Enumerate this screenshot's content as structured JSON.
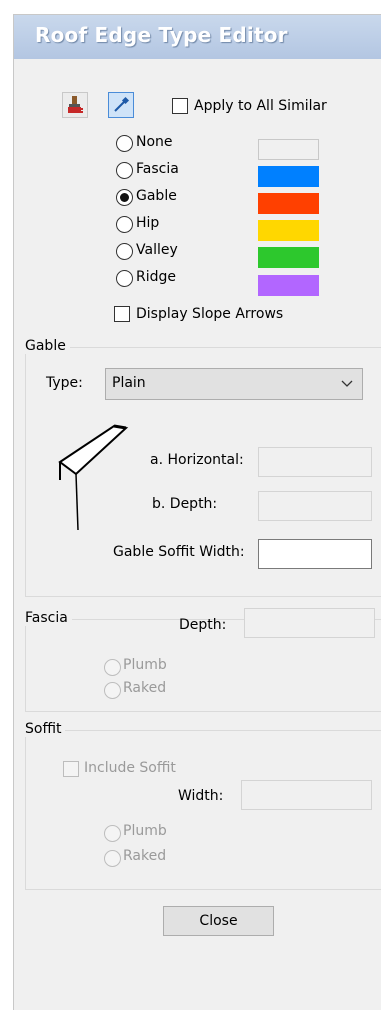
{
  "window": {
    "title": "Roof Edge Type Editor"
  },
  "toolbar": {
    "paint_icon": "paintbrush-icon",
    "picker_icon": "eyedropper-icon",
    "apply_all_label": "Apply to All Similar",
    "apply_all_checked": false
  },
  "edge_types": [
    {
      "label": "None",
      "color": "#f0f0f0",
      "selected": false
    },
    {
      "label": "Fascia",
      "color": "#0080ff",
      "selected": false
    },
    {
      "label": "Gable",
      "color": "#ff4000",
      "selected": true
    },
    {
      "label": "Hip",
      "color": "#ffd700",
      "selected": false
    },
    {
      "label": "Valley",
      "color": "#2dc82d",
      "selected": false
    },
    {
      "label": "Ridge",
      "color": "#b266ff",
      "selected": false
    }
  ],
  "display_slope_arrows": {
    "label": "Display Slope Arrows",
    "checked": false
  },
  "gable": {
    "title": "Gable",
    "type_label": "Type:",
    "type_value": "Plain",
    "horizontal_label": "a. Horizontal:",
    "horizontal_value": "",
    "depth_label": "b. Depth:",
    "depth_value": "",
    "soffit_width_label": "Gable Soffit Width:",
    "soffit_width_value": ""
  },
  "fascia": {
    "title": "Fascia",
    "depth_label": "Depth:",
    "depth_value": "",
    "plumb_label": "Plumb",
    "raked_label": "Raked"
  },
  "soffit": {
    "title": "Soffit",
    "include_label": "Include Soffit",
    "width_label": "Width:",
    "width_value": "",
    "plumb_label": "Plumb",
    "raked_label": "Raked"
  },
  "buttons": {
    "close_label": "Close"
  }
}
